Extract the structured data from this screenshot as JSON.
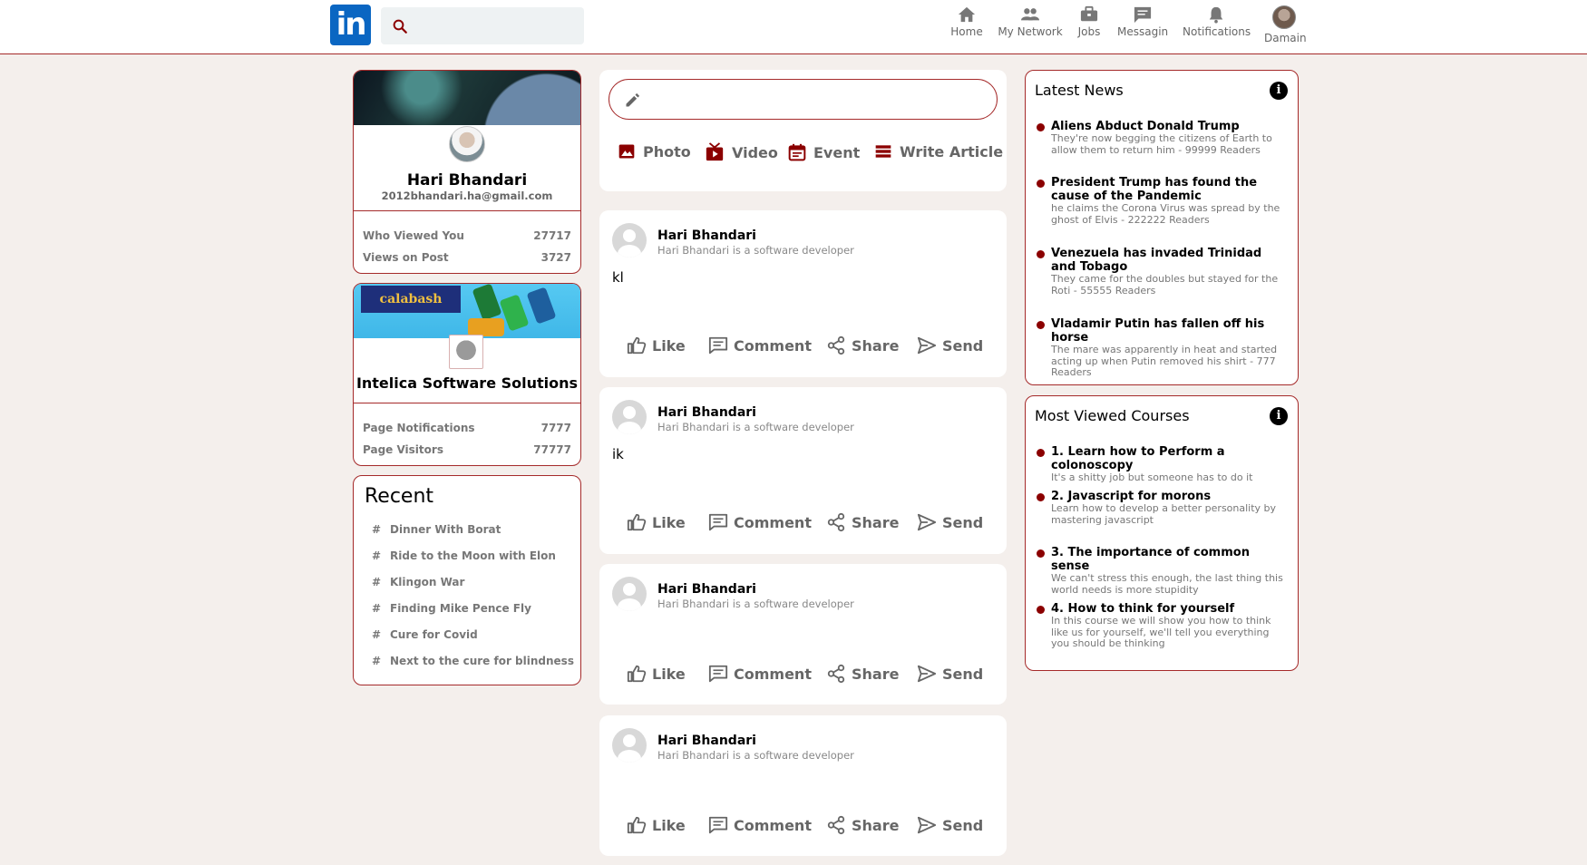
{
  "header": {
    "logo_text": "in",
    "search": {
      "placeholder": ""
    },
    "nav": [
      {
        "label": "Home",
        "icon": "home-icon"
      },
      {
        "label": "My Network",
        "icon": "people-icon"
      },
      {
        "label": "Jobs",
        "icon": "briefcase-icon"
      },
      {
        "label": "Messagin",
        "icon": "message-icon"
      },
      {
        "label": "Notifications",
        "icon": "bell-icon"
      },
      {
        "label": "Damain",
        "icon": "avatar"
      }
    ]
  },
  "profile": {
    "name": "Hari Bhandari",
    "email": "2012bhandari.ha@gmail.com",
    "stats": [
      {
        "label": "Who Viewed You",
        "value": "27717"
      },
      {
        "label": "Views on Post",
        "value": "3727"
      }
    ]
  },
  "company": {
    "banner_text": "calabash",
    "name": "Intelica Software Solutions",
    "stats": [
      {
        "label": "Page Notifications",
        "value": "7777"
      },
      {
        "label": "Page Visitors",
        "value": "77777"
      }
    ]
  },
  "recent": {
    "title": "Recent",
    "items": [
      "Dinner With Borat",
      "Ride to the Moon with Elon",
      "Klingon War",
      "Finding Mike Pence Fly",
      "Cure for Covid",
      "Next to the cure for blindness"
    ]
  },
  "composer": {
    "placeholder": "",
    "options": [
      {
        "label": "Photo",
        "icon": "photo-icon"
      },
      {
        "label": "Video",
        "icon": "video-icon"
      },
      {
        "label": "Event",
        "icon": "calendar-icon"
      },
      {
        "label": "Write Article",
        "icon": "article-icon"
      }
    ]
  },
  "posts": [
    {
      "author": "Hari Bhandari",
      "subtitle": "Hari Bhandari is a software developer",
      "text": "kl"
    },
    {
      "author": "Hari Bhandari",
      "subtitle": "Hari Bhandari is a software developer",
      "text": "ik"
    },
    {
      "author": "Hari Bhandari",
      "subtitle": "Hari Bhandari is a software developer",
      "text": ""
    },
    {
      "author": "Hari Bhandari",
      "subtitle": "Hari Bhandari is a software developer",
      "text": ""
    }
  ],
  "post_actions": {
    "like": "Like",
    "comment": "Comment",
    "share": "Share",
    "send": "Send"
  },
  "latest_news": {
    "title": "Latest News",
    "items": [
      {
        "headline": "Aliens Abduct Donald Trump",
        "desc": "They're now begging the citizens of Earth to allow them to return him - 99999 Readers"
      },
      {
        "headline": "President Trump has found the cause of the Pandemic",
        "desc": "he claims the Corona Virus was spread by the ghost of Elvis - 222222 Readers"
      },
      {
        "headline": "Venezuela has invaded Trinidad and Tobago",
        "desc": "They came for the doubles but stayed for the Roti - 55555 Readers"
      },
      {
        "headline": "Vladamir Putin has fallen off his horse",
        "desc": "The mare was apparently in heat and started acting up when Putin removed his shirt - 777 Readers"
      }
    ]
  },
  "courses": {
    "title": "Most Viewed Courses",
    "items": [
      {
        "headline": "1. Learn how to Perform a colonoscopy",
        "desc": "It's a shitty job but someone has to do it"
      },
      {
        "headline": "2. Javascript for morons",
        "desc": "Learn how to develop a better personality by mastering javascript"
      },
      {
        "headline": "3. The importance of common sense",
        "desc": "We can't stress this enough, the last thing this world needs is more stupidity"
      },
      {
        "headline": "4. How to think for yourself",
        "desc": "In this course we will show you how to think like us for yourself, we'll tell you everything you should be thinking"
      }
    ]
  }
}
